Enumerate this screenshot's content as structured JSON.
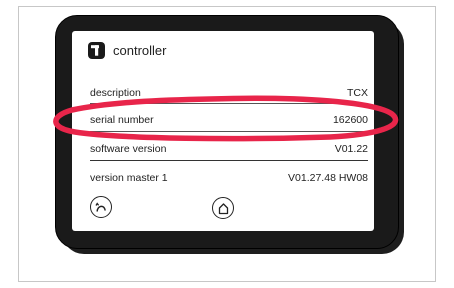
{
  "controller": {
    "title": "controller",
    "logo_icon": "T-logo-icon"
  },
  "rows": [
    {
      "label": "description",
      "value": "TCX"
    },
    {
      "label": "serial number",
      "value": "162600"
    },
    {
      "label": "software version",
      "value": "V01.22"
    },
    {
      "label": "version master 1",
      "value": "V01.27.48 HW08"
    }
  ],
  "nav": {
    "back_icon": "curve-arrow-icon",
    "home_icon": "home-icon"
  },
  "colors": {
    "highlight": "#e8254a",
    "device": "#1a1a1a",
    "screen": "#ffffff"
  }
}
